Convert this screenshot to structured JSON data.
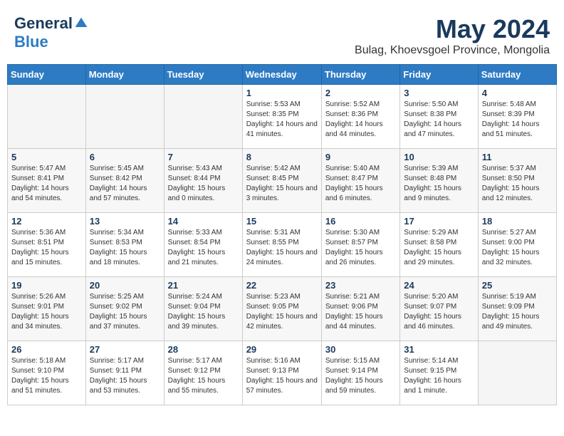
{
  "logo": {
    "general": "General",
    "blue": "Blue"
  },
  "title": "May 2024",
  "subtitle": "Bulag, Khoevsgoel Province, Mongolia",
  "headers": [
    "Sunday",
    "Monday",
    "Tuesday",
    "Wednesday",
    "Thursday",
    "Friday",
    "Saturday"
  ],
  "weeks": [
    [
      {
        "num": "",
        "empty": true
      },
      {
        "num": "",
        "empty": true
      },
      {
        "num": "",
        "empty": true
      },
      {
        "num": "1",
        "sunrise": "5:53 AM",
        "sunset": "8:35 PM",
        "daylight": "14 hours and 41 minutes."
      },
      {
        "num": "2",
        "sunrise": "5:52 AM",
        "sunset": "8:36 PM",
        "daylight": "14 hours and 44 minutes."
      },
      {
        "num": "3",
        "sunrise": "5:50 AM",
        "sunset": "8:38 PM",
        "daylight": "14 hours and 47 minutes."
      },
      {
        "num": "4",
        "sunrise": "5:48 AM",
        "sunset": "8:39 PM",
        "daylight": "14 hours and 51 minutes."
      }
    ],
    [
      {
        "num": "5",
        "sunrise": "5:47 AM",
        "sunset": "8:41 PM",
        "daylight": "14 hours and 54 minutes."
      },
      {
        "num": "6",
        "sunrise": "5:45 AM",
        "sunset": "8:42 PM",
        "daylight": "14 hours and 57 minutes."
      },
      {
        "num": "7",
        "sunrise": "5:43 AM",
        "sunset": "8:44 PM",
        "daylight": "15 hours and 0 minutes."
      },
      {
        "num": "8",
        "sunrise": "5:42 AM",
        "sunset": "8:45 PM",
        "daylight": "15 hours and 3 minutes."
      },
      {
        "num": "9",
        "sunrise": "5:40 AM",
        "sunset": "8:47 PM",
        "daylight": "15 hours and 6 minutes."
      },
      {
        "num": "10",
        "sunrise": "5:39 AM",
        "sunset": "8:48 PM",
        "daylight": "15 hours and 9 minutes."
      },
      {
        "num": "11",
        "sunrise": "5:37 AM",
        "sunset": "8:50 PM",
        "daylight": "15 hours and 12 minutes."
      }
    ],
    [
      {
        "num": "12",
        "sunrise": "5:36 AM",
        "sunset": "8:51 PM",
        "daylight": "15 hours and 15 minutes."
      },
      {
        "num": "13",
        "sunrise": "5:34 AM",
        "sunset": "8:53 PM",
        "daylight": "15 hours and 18 minutes."
      },
      {
        "num": "14",
        "sunrise": "5:33 AM",
        "sunset": "8:54 PM",
        "daylight": "15 hours and 21 minutes."
      },
      {
        "num": "15",
        "sunrise": "5:31 AM",
        "sunset": "8:55 PM",
        "daylight": "15 hours and 24 minutes."
      },
      {
        "num": "16",
        "sunrise": "5:30 AM",
        "sunset": "8:57 PM",
        "daylight": "15 hours and 26 minutes."
      },
      {
        "num": "17",
        "sunrise": "5:29 AM",
        "sunset": "8:58 PM",
        "daylight": "15 hours and 29 minutes."
      },
      {
        "num": "18",
        "sunrise": "5:27 AM",
        "sunset": "9:00 PM",
        "daylight": "15 hours and 32 minutes."
      }
    ],
    [
      {
        "num": "19",
        "sunrise": "5:26 AM",
        "sunset": "9:01 PM",
        "daylight": "15 hours and 34 minutes."
      },
      {
        "num": "20",
        "sunrise": "5:25 AM",
        "sunset": "9:02 PM",
        "daylight": "15 hours and 37 minutes."
      },
      {
        "num": "21",
        "sunrise": "5:24 AM",
        "sunset": "9:04 PM",
        "daylight": "15 hours and 39 minutes."
      },
      {
        "num": "22",
        "sunrise": "5:23 AM",
        "sunset": "9:05 PM",
        "daylight": "15 hours and 42 minutes."
      },
      {
        "num": "23",
        "sunrise": "5:21 AM",
        "sunset": "9:06 PM",
        "daylight": "15 hours and 44 minutes."
      },
      {
        "num": "24",
        "sunrise": "5:20 AM",
        "sunset": "9:07 PM",
        "daylight": "15 hours and 46 minutes."
      },
      {
        "num": "25",
        "sunrise": "5:19 AM",
        "sunset": "9:09 PM",
        "daylight": "15 hours and 49 minutes."
      }
    ],
    [
      {
        "num": "26",
        "sunrise": "5:18 AM",
        "sunset": "9:10 PM",
        "daylight": "15 hours and 51 minutes."
      },
      {
        "num": "27",
        "sunrise": "5:17 AM",
        "sunset": "9:11 PM",
        "daylight": "15 hours and 53 minutes."
      },
      {
        "num": "28",
        "sunrise": "5:17 AM",
        "sunset": "9:12 PM",
        "daylight": "15 hours and 55 minutes."
      },
      {
        "num": "29",
        "sunrise": "5:16 AM",
        "sunset": "9:13 PM",
        "daylight": "15 hours and 57 minutes."
      },
      {
        "num": "30",
        "sunrise": "5:15 AM",
        "sunset": "9:14 PM",
        "daylight": "15 hours and 59 minutes."
      },
      {
        "num": "31",
        "sunrise": "5:14 AM",
        "sunset": "9:15 PM",
        "daylight": "16 hours and 1 minute."
      },
      {
        "num": "",
        "empty": true
      }
    ]
  ]
}
